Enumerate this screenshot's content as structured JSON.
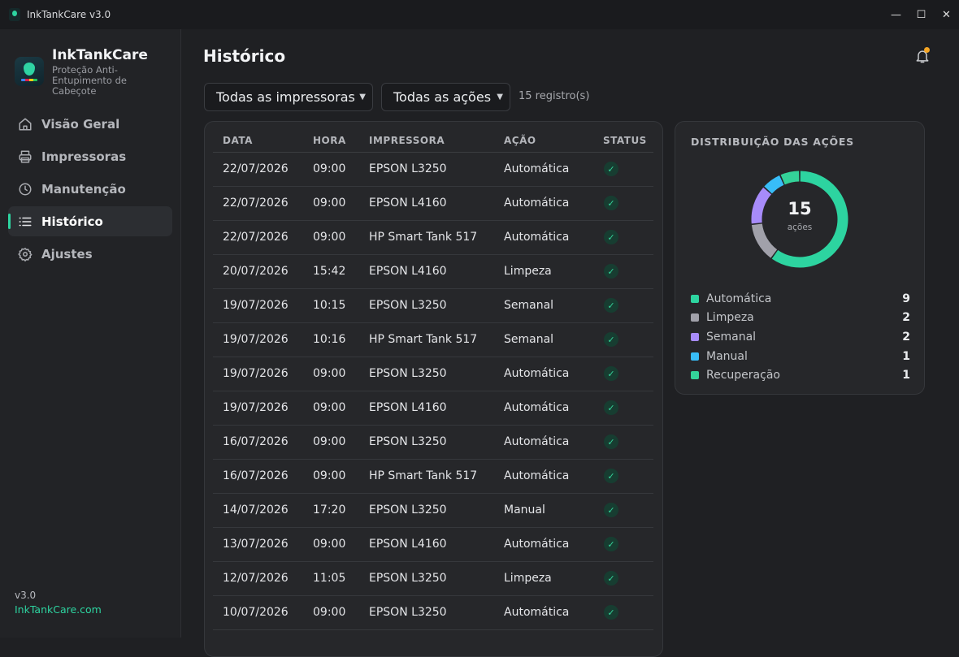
{
  "window": {
    "title": "InkTankCare v3.0",
    "controls": [
      "—",
      "☐",
      "✕"
    ]
  },
  "sidebar": {
    "brand_name": "InkTankCare",
    "brand_subtitle": "Proteção Anti-Entupimento de Cabeçote",
    "items": [
      {
        "label": "Visão Geral",
        "icon": "home-icon",
        "active": false
      },
      {
        "label": "Impressoras",
        "icon": "printer-icon",
        "active": false
      },
      {
        "label": "Manutenção",
        "icon": "clock-icon",
        "active": false
      },
      {
        "label": "Histórico",
        "icon": "list-icon",
        "active": true
      },
      {
        "label": "Ajustes",
        "icon": "gear-icon",
        "active": false
      }
    ],
    "version": "v3.0",
    "site": "InkTankCare.com"
  },
  "main": {
    "title": "Histórico",
    "filters": {
      "printer": "Todas as impressoras",
      "action": "Todas as ações"
    },
    "count": "15 registro(s)",
    "table": {
      "columns": [
        "DATA",
        "HORA",
        "IMPRESSORA",
        "AÇÃO",
        "STATUS"
      ],
      "rows": [
        [
          "22/07/2026",
          "09:00",
          "EPSON L3250",
          "Automática",
          "✓"
        ],
        [
          "22/07/2026",
          "09:00",
          "EPSON L4160",
          "Automática",
          "✓"
        ],
        [
          "22/07/2026",
          "09:00",
          "HP Smart Tank 517",
          "Automática",
          "✓"
        ],
        [
          "20/07/2026",
          "15:42",
          "EPSON L4160",
          "Limpeza",
          "✓"
        ],
        [
          "19/07/2026",
          "10:15",
          "EPSON L3250",
          "Semanal",
          "✓"
        ],
        [
          "19/07/2026",
          "10:16",
          "HP Smart Tank 517",
          "Semanal",
          "✓"
        ],
        [
          "19/07/2026",
          "09:00",
          "EPSON L3250",
          "Automática",
          "✓"
        ],
        [
          "19/07/2026",
          "09:00",
          "EPSON L4160",
          "Automática",
          "✓"
        ],
        [
          "16/07/2026",
          "09:00",
          "EPSON L3250",
          "Automática",
          "✓"
        ],
        [
          "16/07/2026",
          "09:00",
          "HP Smart Tank 517",
          "Automática",
          "✓"
        ],
        [
          "14/07/2026",
          "17:20",
          "EPSON L3250",
          "Manual",
          "✓"
        ],
        [
          "13/07/2026",
          "09:00",
          "EPSON L4160",
          "Automática",
          "✓"
        ],
        [
          "12/07/2026",
          "11:05",
          "EPSON L3250",
          "Limpeza",
          "✓"
        ],
        [
          "10/07/2026",
          "09:00",
          "EPSON L3250",
          "Automática",
          "✓"
        ]
      ]
    },
    "distribution": {
      "title": "DISTRIBUIÇÃO DAS AÇÕES",
      "total": "15",
      "unit": "ações",
      "items": [
        {
          "label": "Automática",
          "value": 9,
          "color": "#2dd4a0"
        },
        {
          "label": "Limpeza",
          "value": 2,
          "color": "#a1a1aa"
        },
        {
          "label": "Semanal",
          "value": 2,
          "color": "#a78bfa"
        },
        {
          "label": "Manual",
          "value": 1,
          "color": "#38bdf8"
        },
        {
          "label": "Recuperação",
          "value": 1,
          "color": "#34d399"
        }
      ]
    }
  },
  "colors": {
    "accent": "#2dd4a0",
    "notification": "#f5a524"
  }
}
